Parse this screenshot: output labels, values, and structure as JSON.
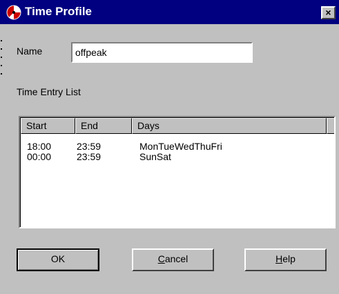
{
  "window": {
    "title": "Time Profile",
    "close_glyph": "×"
  },
  "form": {
    "name_label": "Name",
    "name_value": "offpeak",
    "list_label": "Time Entry List"
  },
  "list": {
    "columns": [
      "Start",
      "End",
      "Days"
    ],
    "rows": [
      {
        "start": "18:00",
        "end": "23:59",
        "days": "MonTueWedThuFri"
      },
      {
        "start": "00:00",
        "end": "23:59",
        "days": "SunSat"
      }
    ]
  },
  "buttons": {
    "ok": "OK",
    "cancel_mnemonic": "C",
    "cancel_rest": "ancel",
    "help_mnemonic": "H",
    "help_rest": "elp"
  },
  "colors": {
    "titlebar": "#000080",
    "face": "#c0c0c0",
    "icon_red": "#cc0000"
  },
  "icons": {
    "app": "time-profile-app-icon",
    "close": "close-icon"
  }
}
